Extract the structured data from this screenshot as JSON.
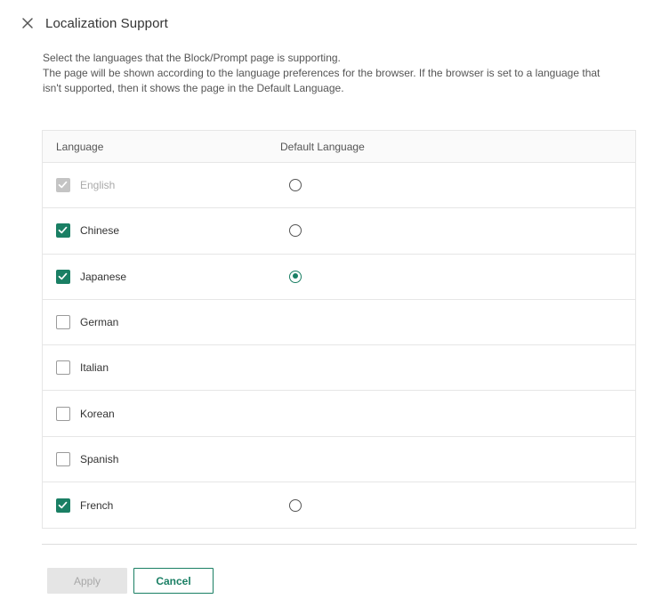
{
  "dialog": {
    "title": "Localization Support",
    "close_icon": "close-icon",
    "description": [
      "Select the languages that the Block/Prompt page is supporting.",
      "The page will be shown according to the language preferences for the browser. If the browser is set to a language that isn't supported, then it shows the page in the Default Language."
    ]
  },
  "table": {
    "headers": {
      "language": "Language",
      "default_language": "Default Language"
    },
    "rows": [
      {
        "label": "English",
        "checked": true,
        "disabled": true,
        "has_radio": true,
        "radio_selected": false
      },
      {
        "label": "Chinese",
        "checked": true,
        "disabled": false,
        "has_radio": true,
        "radio_selected": false
      },
      {
        "label": "Japanese",
        "checked": true,
        "disabled": false,
        "has_radio": true,
        "radio_selected": true
      },
      {
        "label": "German",
        "checked": false,
        "disabled": false,
        "has_radio": false,
        "radio_selected": false
      },
      {
        "label": "Italian",
        "checked": false,
        "disabled": false,
        "has_radio": false,
        "radio_selected": false
      },
      {
        "label": "Korean",
        "checked": false,
        "disabled": false,
        "has_radio": false,
        "radio_selected": false
      },
      {
        "label": "Spanish",
        "checked": false,
        "disabled": false,
        "has_radio": false,
        "radio_selected": false
      },
      {
        "label": "French",
        "checked": true,
        "disabled": false,
        "has_radio": true,
        "radio_selected": false
      }
    ]
  },
  "footer": {
    "apply_label": "Apply",
    "apply_disabled": true,
    "cancel_label": "Cancel"
  },
  "colors": {
    "accent": "#1a7f64",
    "disabled": "#c4c4c4",
    "border": "#e6e6e6"
  }
}
